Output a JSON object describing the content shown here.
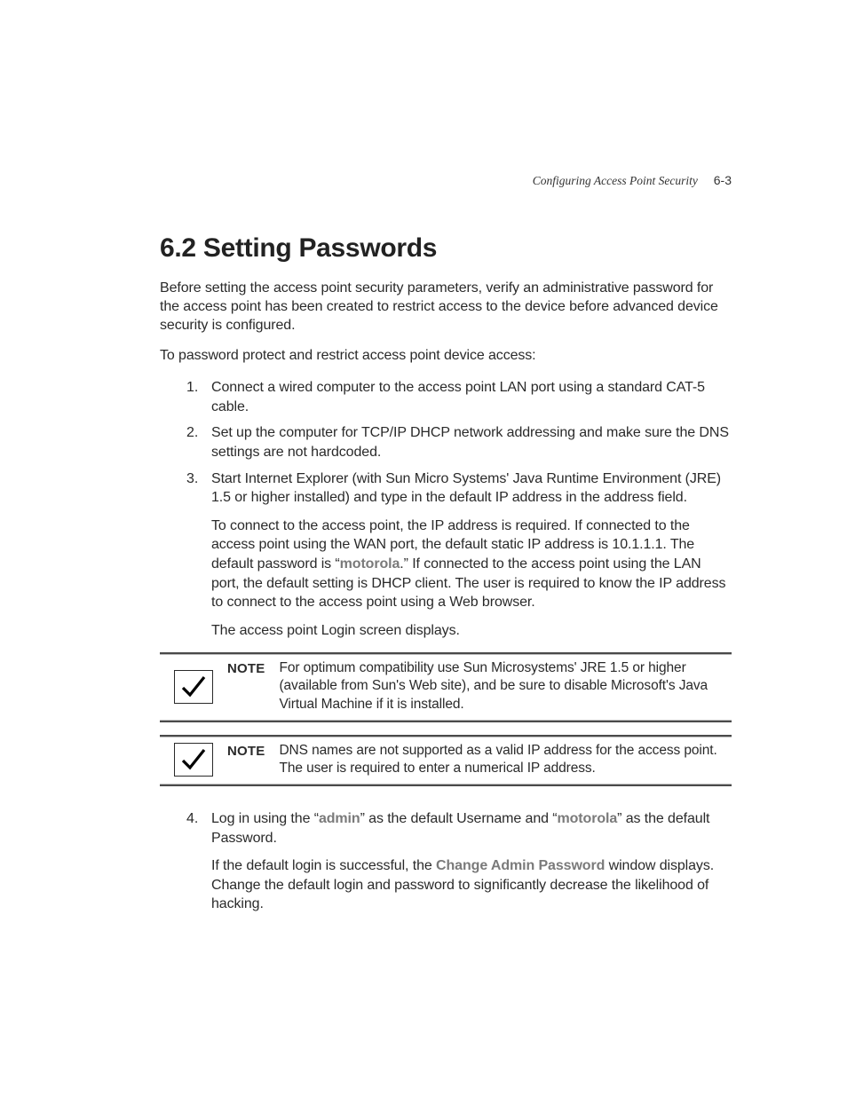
{
  "header": {
    "title": "Configuring Access Point Security",
    "page": "6-3"
  },
  "section": {
    "number": "6.2",
    "title": "Setting Passwords"
  },
  "intro": {
    "p1": "Before setting the access point security parameters, verify an administrative password for the access point has been created to restrict access to the device before advanced device security is configured.",
    "p2": "To password protect and restrict access point device access:"
  },
  "steps": {
    "s1": "Connect a wired computer to the access point LAN port using a standard CAT-5 cable.",
    "s2": "Set up the computer for TCP/IP DHCP network addressing and make sure the DNS settings are not hardcoded.",
    "s3a": "Start Internet Explorer (with Sun Micro Systems' Java Runtime Environment (JRE) 1.5 or higher installed) and type in the default IP address in the address field.",
    "s3b_pre": "To connect to the access point, the IP address is required. If connected to the access point using the WAN port, the default static IP address is 10.1.1.1. The default password is “",
    "s3b_bold": "motorola",
    "s3b_post": ".” If connected to the access point using the LAN port, the default setting is DHCP client. The user is required to know the IP address to connect to the access point using a Web browser.",
    "s3c": "The access point Login screen displays.",
    "s4a_pre": "Log in using the “",
    "s4a_b1": "admin",
    "s4a_mid": "” as the default Username and “",
    "s4a_b2": "motorola",
    "s4a_post": "” as the default Password.",
    "s4b_pre": "If the default login is successful, the ",
    "s4b_bold": "Change Admin Password",
    "s4b_post": " window displays. Change the default login and password to significantly decrease the likelihood of hacking."
  },
  "notes": {
    "label": "NOTE",
    "n1": "For optimum compatibility use Sun Microsystems' JRE 1.5 or higher (available from Sun's Web site), and be sure to disable Microsoft's Java Virtual Machine if it is installed.",
    "n2": "DNS names are not supported as a valid IP address for the access point. The user is required to enter a numerical IP address."
  }
}
